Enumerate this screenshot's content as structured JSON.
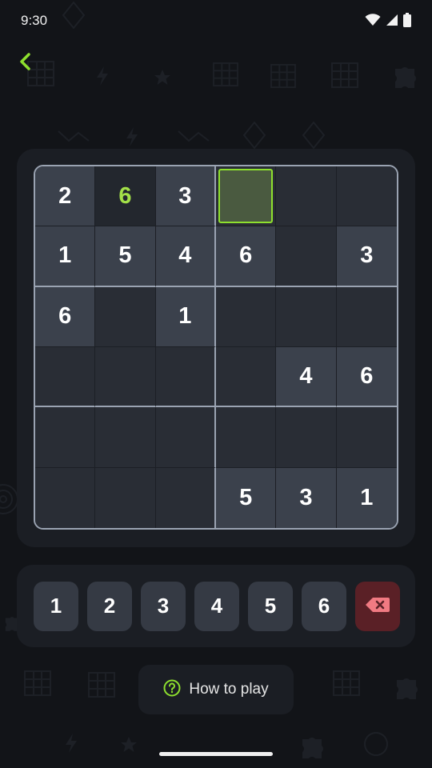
{
  "status_bar": {
    "time": "9:30",
    "icons": [
      "wifi-icon",
      "cell-signal-icon",
      "battery-icon"
    ]
  },
  "navigation": {
    "back_icon": "chevron-left-icon"
  },
  "board": {
    "size": 6,
    "box_rows": 2,
    "box_cols": 3,
    "selected_cell": [
      0,
      3
    ],
    "cells": [
      [
        {
          "v": "2",
          "t": "given"
        },
        {
          "v": "6",
          "t": "user"
        },
        {
          "v": "3",
          "t": "given"
        },
        {
          "v": "",
          "t": "selected"
        },
        {
          "v": "",
          "t": "empty"
        },
        {
          "v": "",
          "t": "empty"
        }
      ],
      [
        {
          "v": "1",
          "t": "given"
        },
        {
          "v": "5",
          "t": "given"
        },
        {
          "v": "4",
          "t": "given"
        },
        {
          "v": "6",
          "t": "given"
        },
        {
          "v": "",
          "t": "empty"
        },
        {
          "v": "3",
          "t": "given"
        }
      ],
      [
        {
          "v": "6",
          "t": "given"
        },
        {
          "v": "",
          "t": "empty"
        },
        {
          "v": "1",
          "t": "given"
        },
        {
          "v": "",
          "t": "empty"
        },
        {
          "v": "",
          "t": "empty"
        },
        {
          "v": "",
          "t": "empty"
        }
      ],
      [
        {
          "v": "",
          "t": "empty"
        },
        {
          "v": "",
          "t": "empty"
        },
        {
          "v": "",
          "t": "empty"
        },
        {
          "v": "",
          "t": "empty"
        },
        {
          "v": "4",
          "t": "given"
        },
        {
          "v": "6",
          "t": "given"
        }
      ],
      [
        {
          "v": "",
          "t": "empty"
        },
        {
          "v": "",
          "t": "empty"
        },
        {
          "v": "",
          "t": "empty"
        },
        {
          "v": "",
          "t": "empty"
        },
        {
          "v": "",
          "t": "empty"
        },
        {
          "v": "",
          "t": "empty"
        }
      ],
      [
        {
          "v": "",
          "t": "empty"
        },
        {
          "v": "",
          "t": "empty"
        },
        {
          "v": "",
          "t": "empty"
        },
        {
          "v": "5",
          "t": "given"
        },
        {
          "v": "3",
          "t": "given"
        },
        {
          "v": "1",
          "t": "given"
        }
      ]
    ]
  },
  "number_pad": {
    "keys": [
      "1",
      "2",
      "3",
      "4",
      "5",
      "6"
    ],
    "erase_icon": "backspace-icon"
  },
  "help_button": {
    "icon": "question-circle-icon",
    "label": "How to play"
  },
  "colors": {
    "accent": "#8ee02e",
    "user_digit": "#a3e048",
    "erase": "#5a2026"
  }
}
